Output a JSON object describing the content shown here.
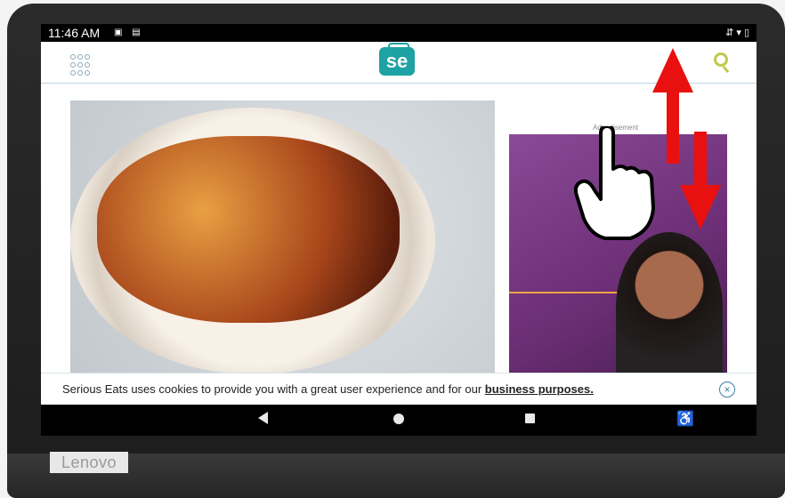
{
  "device": {
    "brand": "Lenovo"
  },
  "status_bar": {
    "time": "11:46 AM",
    "left_icons": "▣ ▤",
    "right_icons": "⇵ ▾ ▯"
  },
  "app": {
    "logo_text": "se",
    "grid_icon": "grid-icon",
    "search_icon": "search-icon"
  },
  "ad": {
    "label": "Advertisement"
  },
  "cookie_banner": {
    "text": "Serious Eats uses cookies to provide you with a great user experience and for our ",
    "link": "business purposes.",
    "close_icon": "close-icon"
  },
  "nav_bar": {
    "back_icon": "back-icon",
    "home_icon": "home-icon",
    "recent_icon": "recent-apps-icon",
    "accessibility_icon": "accessibility-icon",
    "accessibility_glyph": "♿"
  },
  "overlay": {
    "gesture": "swipe-up-down",
    "hand_icon": "pointing-hand-icon",
    "colors": {
      "arrow": "#e8110f"
    }
  }
}
